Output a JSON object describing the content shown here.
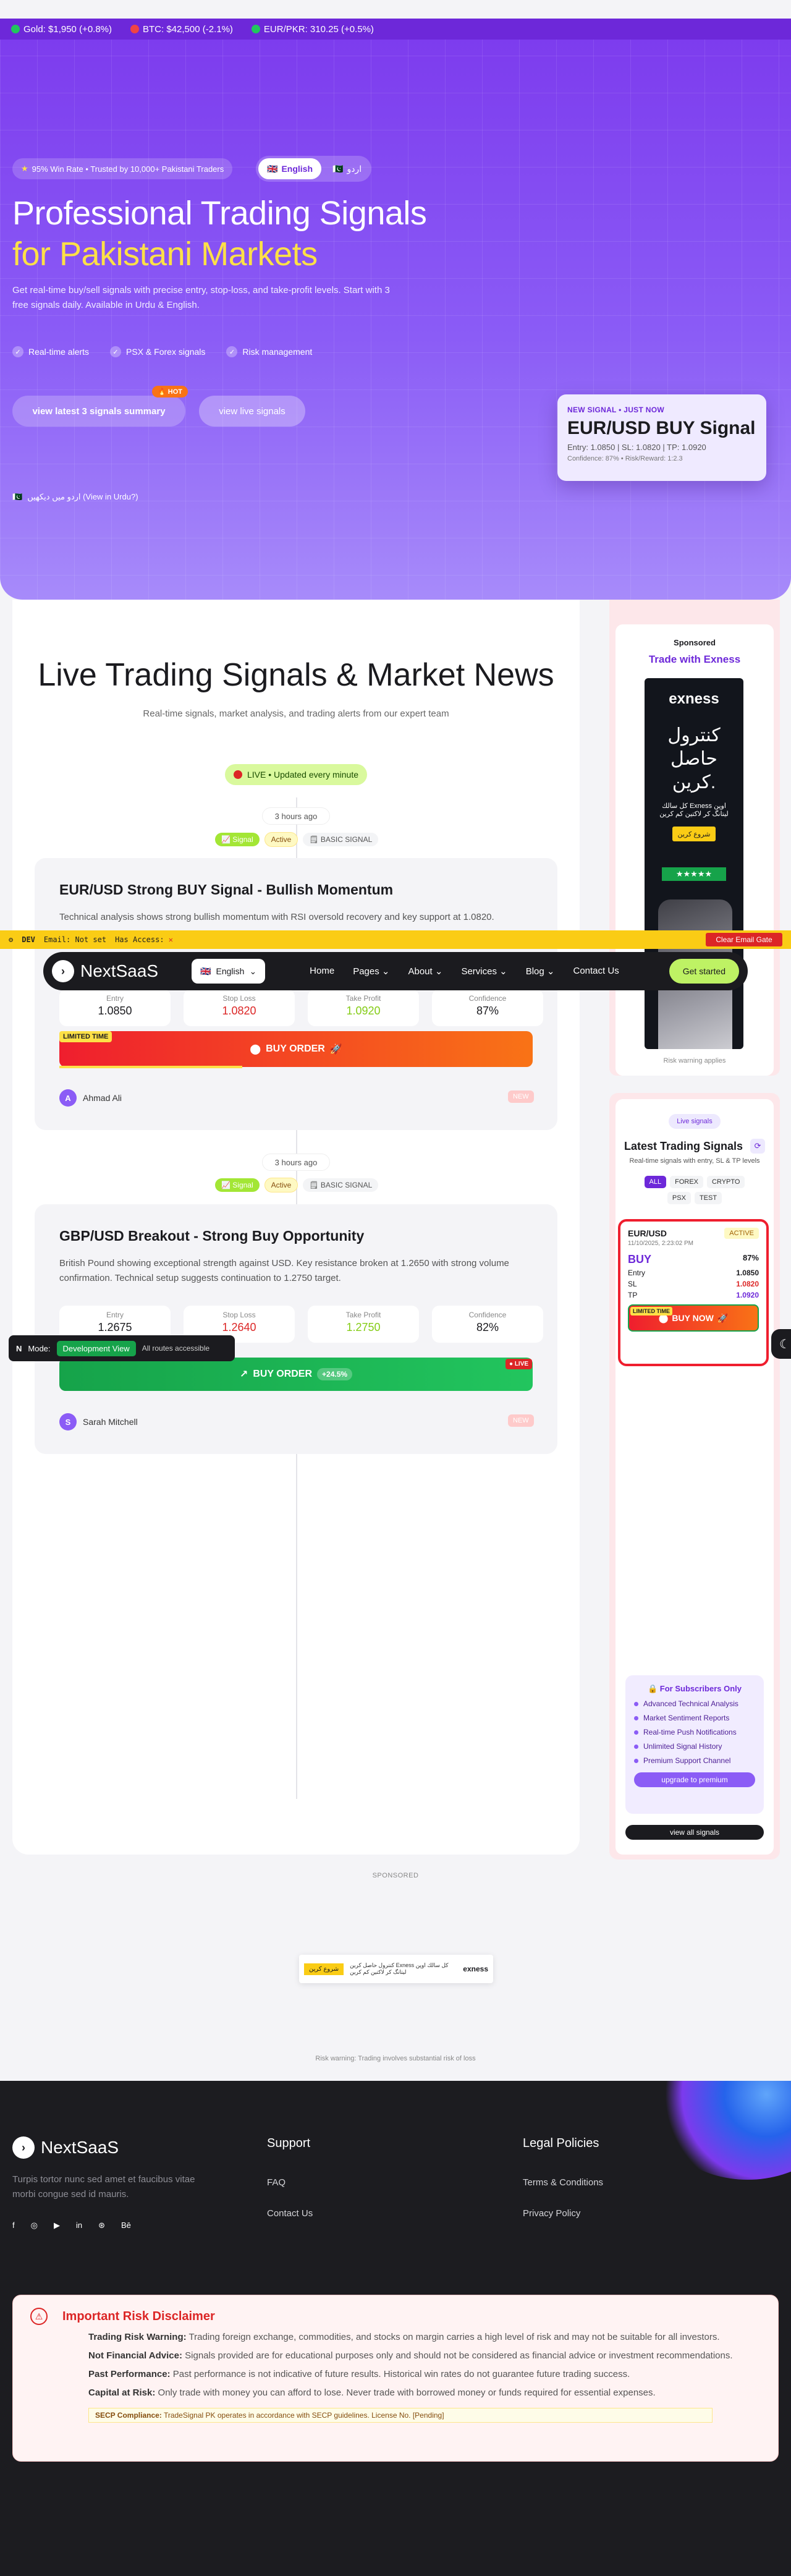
{
  "ticker": [
    {
      "label": "Gold: $1,950 (+0.8%)",
      "color": "#22c55e"
    },
    {
      "label": "BTC: $42,500 (-2.1%)",
      "color": "#ef4444"
    },
    {
      "label": "EUR/PKR: 310.25 (+0.5%)",
      "color": "#22c55e"
    }
  ],
  "hero": {
    "badge": "95% Win Rate • Trusted by 10,000+ Pakistani Traders",
    "lang_en": "English",
    "lang_ur": "اردو",
    "title_line1": "Professional Trading Signals",
    "title_line2": "for Pakistani Markets",
    "description": "Get real-time buy/sell signals with precise entry, stop-loss, and take-profit levels. Start with 3 free signals daily. Available in Urdu & English.",
    "features": [
      "Real-time alerts",
      "PSX & Forex signals",
      "Risk management"
    ],
    "cta_summary": "view latest 3 signals summary",
    "hot_badge": "🔥 HOT",
    "cta_live": "view live signals",
    "urdu_link": "اردو میں دیکھیں (View in Urdu?)",
    "signal_card": {
      "kicker": "NEW SIGNAL • JUST NOW",
      "title": "EUR/USD BUY Signal",
      "detail": "Entry: 1.0850 | SL: 1.0820 | TP: 1.0920",
      "confidence": "Confidence: 87% • Risk/Reward: 1:2.3"
    }
  },
  "live": {
    "title": "Live Trading Signals & Market News",
    "subtitle": "Real-time signals, market analysis, and trading alerts from our expert team",
    "badge": "LIVE • Updated every minute"
  },
  "signals": [
    {
      "time": "3 hours ago",
      "tag_signal": "Signal",
      "tag_active": "Active",
      "tag_basic": "BASIC SIGNAL",
      "title": "EUR/USD Strong BUY Signal - Bullish Momentum",
      "desc": "Technical analysis shows strong bullish momentum with RSI oversold recovery and key support at 1.0820.",
      "stats": [
        {
          "label": "Entry",
          "value": "1.0850"
        },
        {
          "label": "Stop Loss",
          "value": "1.0820"
        },
        {
          "label": "Take Profit",
          "value": "1.0920"
        },
        {
          "label": "Confidence",
          "value": "87%"
        }
      ],
      "limited": "LIMITED TIME",
      "order": "BUY ORDER",
      "author": "Ahmad Ali",
      "author_initial": "A",
      "new_tag": "NEW"
    },
    {
      "time": "3 hours ago",
      "tag_signal": "Signal",
      "tag_active": "Active",
      "tag_basic": "BASIC SIGNAL",
      "title": "GBP/USD Breakout - Strong Buy Opportunity",
      "desc": "British Pound showing exceptional strength against USD. Key resistance broken at 1.2650 with strong volume confirmation. Technical setup suggests continuation to 1.2750 target.",
      "stats": [
        {
          "label": "Entry",
          "value": "1.2675"
        },
        {
          "label": "Stop Loss",
          "value": "1.2640"
        },
        {
          "label": "Take Profit",
          "value": "1.2750"
        },
        {
          "label": "Confidence",
          "value": "82%"
        }
      ],
      "order": "BUY ORDER",
      "gain": "+24.5%",
      "live": "LIVE",
      "author": "Sarah Mitchell",
      "author_initial": "S",
      "new_tag": "NEW"
    }
  ],
  "dev": {
    "label": "DEV",
    "email": "Email: Not set",
    "access": "Has Access:",
    "clear": "Clear Email Gate"
  },
  "nav": {
    "brand": "NextSaaS",
    "lang": "English",
    "links": [
      "Home",
      "Pages",
      "About",
      "Services",
      "Blog",
      "Contact Us"
    ],
    "cta": "Get started"
  },
  "mode_bar": {
    "mode": "Mode:",
    "dev_view": "Development View",
    "note": "All routes accessible"
  },
  "sidebar": {
    "sponsored": "Sponsored",
    "ad_link": "Trade with Exness",
    "ad_brand": "exness",
    "ad_headline": "كنترول حاصل كرين.",
    "ad_copy": "كل سالك Exness اوپن ليتانگ كر لاكتين كم كرين",
    "ad_cta": "شروع كرين",
    "risk": "Risk warning applies",
    "live_pill": "Live signals",
    "latest_title": "Latest Trading Signals",
    "latest_sub": "Real-time signals with entry, SL & TP levels",
    "filters": [
      "ALL",
      "FOREX",
      "CRYPTO",
      "PSX",
      "TEST"
    ],
    "mini": {
      "pair": "EUR/USD",
      "status": "ACTIVE",
      "date": "11/10/2025, 2:23:02 PM",
      "dir": "BUY",
      "conf": "87%",
      "rows": [
        {
          "k": "Entry",
          "v": "1.0850"
        },
        {
          "k": "SL",
          "v": "1.0820"
        },
        {
          "k": "TP",
          "v": "1.0920"
        }
      ],
      "limited": "LIMITED TIME",
      "btn": "BUY NOW"
    },
    "subs_title": "For Subscribers Only",
    "subs_items": [
      "Advanced Technical Analysis",
      "Market Sentiment Reports",
      "Real-time Push Notifications",
      "Unlimited Signal History",
      "Premium Support Channel"
    ],
    "upgrade": "upgrade to premium",
    "view_all": "view all signals"
  },
  "sponsored_label": "SPONSORED",
  "bottom_ad": {
    "cta": "شروع كرين",
    "text": "كنترول حاصل كرين Exness كل سالك اوپن ليتانگ كر لاكتين كم كرين",
    "brand": "exness"
  },
  "risk_small": "Risk warning: Trading involves substantial risk of loss",
  "footer": {
    "brand": "NextSaaS",
    "tagline": "Turpis tortor nunc sed amet et faucibus vitae morbi congue sed id mauris.",
    "support_title": "Support",
    "support_links": [
      "FAQ",
      "Contact Us"
    ],
    "legal_title": "Legal Policies",
    "legal_links": [
      "Terms & Conditions",
      "Privacy Policy"
    ],
    "socials": [
      "f",
      "◎",
      "▶",
      "in",
      "⊛",
      "Bē"
    ]
  },
  "disclaimer": {
    "title": "Important Risk Disclaimer",
    "items": [
      {
        "k": "Trading Risk Warning:",
        "v": "Trading foreign exchange, commodities, and stocks on margin carries a high level of risk and may not be suitable for all investors."
      },
      {
        "k": "Not Financial Advice:",
        "v": "Signals provided are for educational purposes only and should not be considered as financial advice or investment recommendations."
      },
      {
        "k": "Past Performance:",
        "v": "Past performance is not indicative of future results. Historical win rates do not guarantee future trading success."
      },
      {
        "k": "Capital at Risk:",
        "v": "Only trade with money you can afford to lose. Never trade with borrowed money or funds required for essential expenses."
      }
    ],
    "secp_k": "SECP Compliance:",
    "secp_v": "TradeSignal PK operates in accordance with SECP guidelines. License No. [Pending]"
  },
  "colors": {
    "accent": "#7c3aed",
    "highlight": "#fde047",
    "lime": "#bef264",
    "danger": "#dc2626"
  }
}
